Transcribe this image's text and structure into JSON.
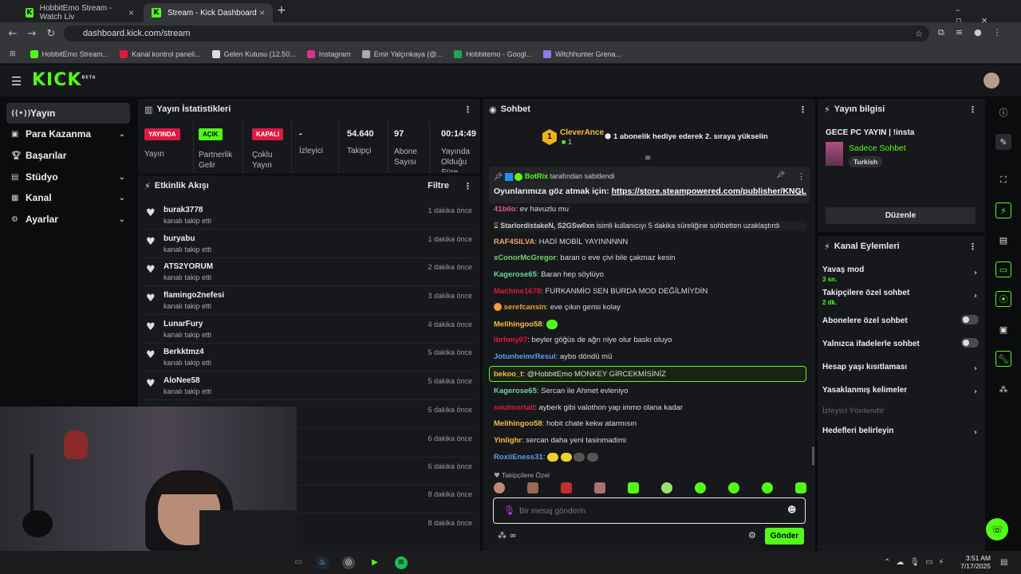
{
  "browser": {
    "tabs": [
      {
        "title": "HobbitEmo Stream - Watch Liv"
      },
      {
        "title": "Stream - Kick Dashboard"
      }
    ],
    "url": "dashboard.kick.com/stream",
    "bookmarks": [
      "HobbitEmo Stream...",
      "Kanal kontrol paneli...",
      "Gelen Kutusu (12.50...",
      "Instagram",
      "Emir Yalçınkaya (@...",
      "Hobbitemo - Googl...",
      "Witchhunter Grena..."
    ]
  },
  "kick": {
    "logo": "KICK",
    "beta": "BETA"
  },
  "leftnav": {
    "items": [
      {
        "label": "Yayın",
        "icon": "broadcast-icon",
        "active": true
      },
      {
        "label": "Para Kazanma",
        "icon": "money-icon"
      },
      {
        "label": "Başarılar",
        "icon": "trophy-icon"
      },
      {
        "label": "Stüdyo",
        "icon": "studio-icon"
      },
      {
        "label": "Kanal",
        "icon": "channel-icon"
      },
      {
        "label": "Ayarlar",
        "icon": "gear-icon"
      }
    ]
  },
  "stats": {
    "title": "Yayın İstatistikleri",
    "cells": [
      {
        "badge": "YAYINDA",
        "label": "Yayın",
        "color": "#e0193f"
      },
      {
        "badge": "AÇIK",
        "label": "Partnerlik Gelir",
        "color": "#53fc18"
      },
      {
        "badge": "KAPALI",
        "label": "Çoklu Yayın",
        "color": "#e0193f"
      },
      {
        "value": "-",
        "label": "İzleyici"
      },
      {
        "value": "54.640",
        "label": "Takipçi"
      },
      {
        "value": "97",
        "label": "Abone Sayısı"
      },
      {
        "value": "00:14:49",
        "label": "Yayında Olduğu Süre"
      }
    ]
  },
  "activity": {
    "title": "Etkinlik Akışı",
    "filter": "Filtre",
    "items": [
      {
        "name": "burak3778",
        "sub": "kanalı takip etti",
        "time": "1 dakika önce"
      },
      {
        "name": "buryabu",
        "sub": "kanalı takip etti",
        "time": "1 dakika önce"
      },
      {
        "name": "ATS2YORUM",
        "sub": "kanalı takip etti",
        "time": "2 dakika önce"
      },
      {
        "name": "flamingo2nefesi",
        "sub": "kanalı takip etti",
        "time": "3 dakika önce"
      },
      {
        "name": "LunarFury",
        "sub": "kanalı takip etti",
        "time": "4 dakika önce"
      },
      {
        "name": "Berkktmz4",
        "sub": "kanalı takip etti",
        "time": "5 dakika önce"
      },
      {
        "name": "AloNee58",
        "sub": "kanalı takip etti",
        "time": "5 dakika önce"
      },
      {
        "name": "",
        "sub": "",
        "time": "5 dakika önce"
      },
      {
        "name": "",
        "sub": "",
        "time": "6 dakika önce"
      },
      {
        "name": "",
        "sub": "",
        "time": "6 dakika önce"
      },
      {
        "name": "",
        "sub": "",
        "time": "8 dakika önce"
      },
      {
        "name": "",
        "sub": "",
        "time": "8 dakika önce"
      }
    ]
  },
  "chat": {
    "title": "Sohbet",
    "gift": {
      "user": "CleverAnce",
      "level": "1",
      "text": "1 abonelik hediye ederek 2. sıraya yükselin"
    },
    "pinned": {
      "by": "BotRix",
      "byText": "tarafından sabitlendi",
      "text": "Oyunlarımıza göz atmak için:",
      "link": "https://store.steampowered.com/publisher/KNGL"
    },
    "timeout": {
      "users": "StarlordistakeN, S2GSw0xn",
      "text": "isimli kullanıcıyı 5 dakika süreliğine sohbetten uzaklaştırdı"
    },
    "messages": [
      {
        "user": "41bilo",
        "text": "ev havuzlu mu",
        "color": "#e85a8a"
      },
      {
        "user": "RAF4SILVA",
        "text": "HADİ MOBİL YAYINNNNN",
        "color": "#f0a070"
      },
      {
        "user": "xConorMcGregor",
        "text": "baran o eve çivi bile çakmaz kesin",
        "color": "#6fd46f"
      },
      {
        "user": "Kagerose65",
        "text": "Baran hep söylüyo",
        "color": "#6fd4a0"
      },
      {
        "user": "Machine1678",
        "text": "FURKANMİO SEN BURDA MOD DEĞİLMİYDİN",
        "color": "#e0193f"
      },
      {
        "user": "serefcansin",
        "text": "eve çıkın gerisi kolay",
        "color": "#f0a030"
      },
      {
        "user": "Melihingoo58",
        "text": "",
        "color": "#f0c040"
      },
      {
        "user": "ibrhmy07",
        "text": "beyler göğüs de ağrı niye olur baskı oluyo",
        "color": "#e0193f"
      },
      {
        "user": "JotunheimrResul",
        "text": "aybo döndü mü",
        "color": "#5aa0f0"
      },
      {
        "user": "bekoo_t",
        "text": "@HobbitEmo MONKEY GİRCEKMİSİNİZ",
        "color": "#f0c040"
      },
      {
        "user": "Kagerose65",
        "text": "Sercan ile Ahmet evleniyo",
        "color": "#6fd4a0"
      },
      {
        "user": "soulmortall",
        "text": "ayberk gibi valothon yap immo olana kadar",
        "color": "#e0193f"
      },
      {
        "user": "Melihingoo58",
        "text": "hobit chate kekw atarmısın",
        "color": "#f0c040"
      },
      {
        "user": "Yinlighr",
        "text": "sercan daha yeni tasinmadimi",
        "color": "#f0c040"
      },
      {
        "user": "RoxiiEness31",
        "text": "",
        "color": "#5aa0f0"
      }
    ],
    "followersOnly": "Takipçilere Özel",
    "placeholder": "Bir mesaj gönderin",
    "send": "Gönder"
  },
  "info": {
    "title": "Yayın bilgisi",
    "streamTitle": "GECE PC YAYIN | !insta",
    "category": "Sadece Sohbet",
    "tag": "Turkish",
    "edit": "Düzenle"
  },
  "actions": {
    "title": "Kanal Eylemleri",
    "items": [
      {
        "label": "Yavaş mod",
        "sub": "3 sn.",
        "type": "chev"
      },
      {
        "label": "Takipçilere özel sohbet",
        "sub": "2 dk.",
        "type": "chev"
      },
      {
        "label": "Abonelere özel sohbet",
        "type": "toggle"
      },
      {
        "label": "Yalnızca ifadelerle sohbet",
        "type": "toggle"
      },
      {
        "label": "Hesap yaşı kısıtlaması",
        "type": "chev"
      },
      {
        "label": "Yasaklanmış kelimeler",
        "type": "chev"
      },
      {
        "label": "İzleyici Yönlendir",
        "type": "disabled"
      },
      {
        "label": "Hedefleri belirleyin",
        "type": "chev"
      }
    ]
  },
  "taskbar": {
    "time": "3:51 AM",
    "date": "7/17/2025"
  }
}
